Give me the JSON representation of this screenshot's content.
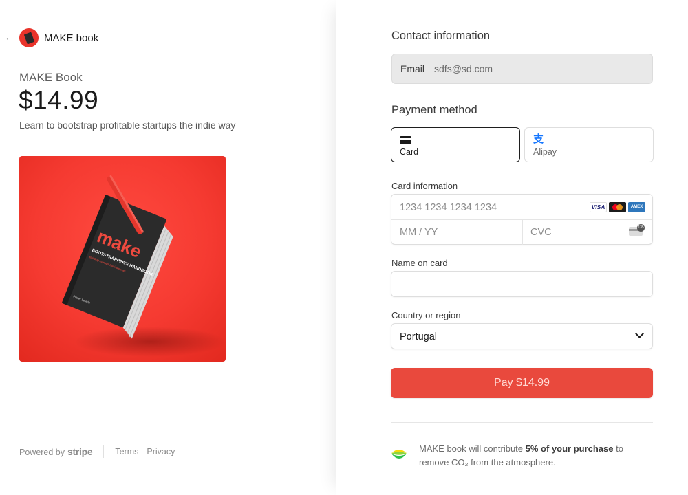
{
  "merchant": {
    "name": "MAKE book",
    "logo_icon": "book-logo-icon"
  },
  "product": {
    "name": "MAKE Book",
    "price": "$14.99",
    "description": "Learn to bootstrap profitable startups the indie way",
    "image": {
      "title": "make",
      "subtitle": "BOOTSTRAPPER'S HANDBOOK",
      "tagline": "Building startups the indie way",
      "author": "Pieter Levels"
    }
  },
  "footer": {
    "powered_by": "Powered by",
    "stripe": "stripe",
    "terms": "Terms",
    "privacy": "Privacy"
  },
  "contact": {
    "title": "Contact information",
    "email_label": "Email",
    "email_value": "sdfs@sd.com"
  },
  "payment": {
    "title": "Payment method",
    "methods": [
      {
        "label": "Card",
        "icon": "credit-card-icon",
        "selected": true
      },
      {
        "label": "Alipay",
        "icon": "alipay-icon",
        "selected": false
      }
    ]
  },
  "card_info": {
    "label": "Card information",
    "number_placeholder": "1234 1234 1234 1234",
    "expiry_placeholder": "MM / YY",
    "cvc_placeholder": "CVC",
    "brands": [
      "VISA",
      "mastercard",
      "AMEX"
    ],
    "cvc_badge": "135"
  },
  "name_on_card": {
    "label": "Name on card",
    "value": ""
  },
  "country": {
    "label": "Country or region",
    "value": "Portugal"
  },
  "pay_button": "Pay $14.99",
  "climate": {
    "text_before": "MAKE book will contribute ",
    "bold": "5% of your purchase",
    "text_after": " to remove CO₂ from the atmosphere."
  },
  "colors": {
    "accent": "#e9493d",
    "product_bg": "#f53a31",
    "alipay": "#1677ff"
  }
}
